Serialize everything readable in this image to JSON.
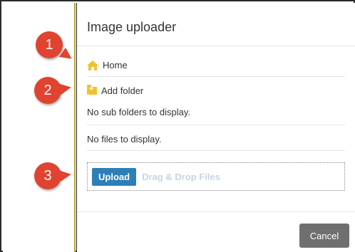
{
  "dialog": {
    "title": "Image uploader",
    "home_label": "Home",
    "add_folder_label": "Add folder",
    "no_subfolders_text": "No sub folders to display.",
    "no_files_text": "No files to display.",
    "upload_label": "Upload",
    "drop_text": "Drag & Drop Files",
    "cancel_label": "Cancel"
  },
  "callouts": [
    {
      "number": "1"
    },
    {
      "number": "2"
    },
    {
      "number": "3"
    }
  ],
  "colors": {
    "callout": "#e0432f",
    "upload_button": "#2d7fb8",
    "cancel_button": "#6f6f6f",
    "folder": "#f2c12e"
  }
}
